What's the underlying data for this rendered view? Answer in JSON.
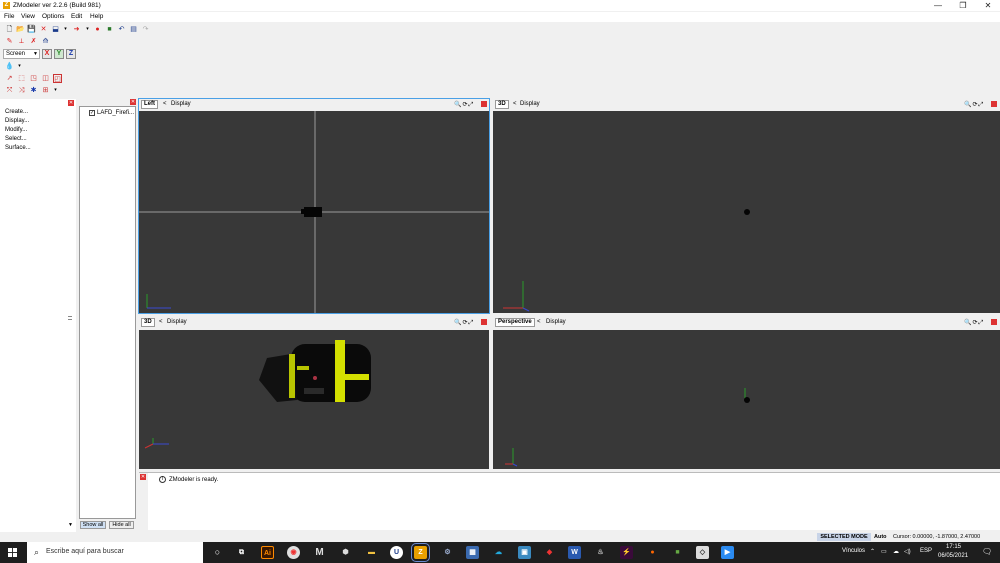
{
  "window": {
    "title": "ZModeler ver 2.2.6 (Build 981)",
    "app_icon": "Z",
    "minimize": "—",
    "maximize": "❐",
    "close": "✕"
  },
  "menu": [
    {
      "label": "File"
    },
    {
      "label": "View"
    },
    {
      "label": "Options"
    },
    {
      "label": "Edit"
    },
    {
      "label": "Help"
    }
  ],
  "toolbar": {
    "screen_select": "Screen",
    "axis_x": "X",
    "axis_y": "Y",
    "axis_z": "Z"
  },
  "command_panel": {
    "items": [
      "Create...",
      "Display...",
      "Modify...",
      "Select...",
      "Surface..."
    ]
  },
  "object_tree": {
    "items": [
      {
        "label": "LAFD_Firefi...",
        "checked": "✓"
      }
    ],
    "show_all": "Show all",
    "hide_all": "Hide all"
  },
  "viewports": [
    {
      "title": "Left",
      "display": "Display",
      "prev": "<"
    },
    {
      "title": "3D",
      "display": "Display",
      "prev": "<"
    },
    {
      "title": "3D",
      "display": "Display",
      "prev": "<"
    },
    {
      "title": "Perspective",
      "display": "Display",
      "prev": "<"
    }
  ],
  "log": {
    "message": "ZModeler is ready.",
    "info_icon": "i"
  },
  "status": {
    "mode": "SELECTED MODE",
    "snap": "Auto",
    "cursor": "Cursor: 0.00000, -1.87000, 2.47000"
  },
  "taskbar": {
    "search_placeholder": "Escribe aquí para buscar",
    "tray_label": "Vínculos",
    "language": "ESP",
    "time": "17:15",
    "date": "06/05/2021"
  },
  "colors": {
    "viewport_bg": "#383838",
    "active_viewport_border": "#4aa0e6",
    "model_stripe": "#d4e000",
    "close_button": "#dd3333",
    "taskbar_bg": "#1e1e1e"
  }
}
